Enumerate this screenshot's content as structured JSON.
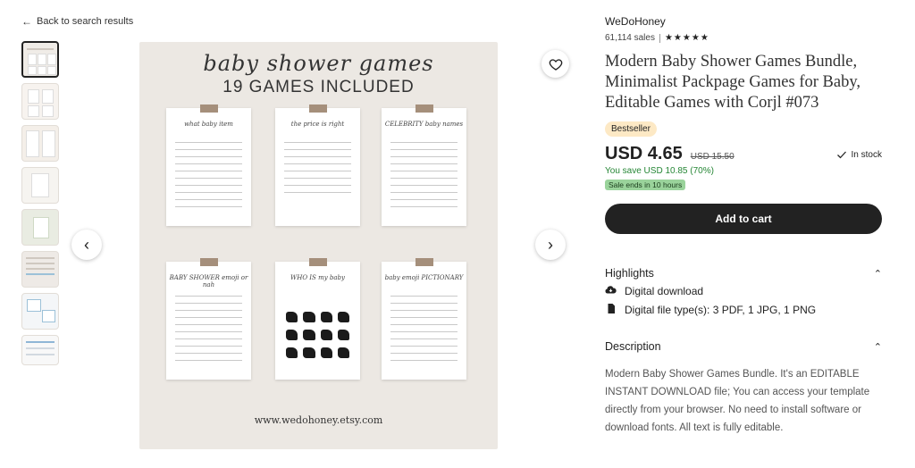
{
  "nav": {
    "back_label": "Back to search results"
  },
  "gallery": {
    "image_title": "baby shower games",
    "image_subtitle": "19 GAMES INCLUDED",
    "image_footer": "www.wedohoney.etsy.com",
    "cards": [
      {
        "title": "what baby item"
      },
      {
        "title": "the price is right"
      },
      {
        "title": "CELEBRITY baby names"
      },
      {
        "title": "BABY SHOWER emoji or nah"
      },
      {
        "title": "WHO IS my baby"
      },
      {
        "title": "baby emoji PICTIONARY"
      }
    ],
    "prev_label": "‹",
    "next_label": "›"
  },
  "listing": {
    "shop_name": "WeDoHoney",
    "sales": "61,114 sales",
    "rating_stars": "★★★★★",
    "title": "Modern Baby Shower Games Bundle, Minimalist Packpage Games for Baby, Editable Games with Corjl #073",
    "badge": "Bestseller",
    "price": "USD 4.65",
    "old_price": "USD 15.50",
    "stock": "In stock",
    "savings": "You save USD 10.85 (70%)",
    "sale_badge": "Sale ends in 10 hours",
    "add_to_cart": "Add to cart"
  },
  "highlights": {
    "heading": "Highlights",
    "items": [
      {
        "icon": "cloud-download-icon",
        "label": "Digital download"
      },
      {
        "icon": "file-icon",
        "label": "Digital file type(s): 3 PDF, 1 JPG, 1 PNG"
      }
    ]
  },
  "description": {
    "heading": "Description",
    "text": "Modern Baby Shower Games Bundle. It's an EDITABLE INSTANT DOWNLOAD file; You can access your template directly from your browser. No need to install software or download fonts. All text is fully editable."
  },
  "colors": {
    "cart_button": "#222222",
    "bestseller_bg": "#fde9c5",
    "sale_badge_bg": "#9ad39b",
    "savings_text": "#258635"
  }
}
